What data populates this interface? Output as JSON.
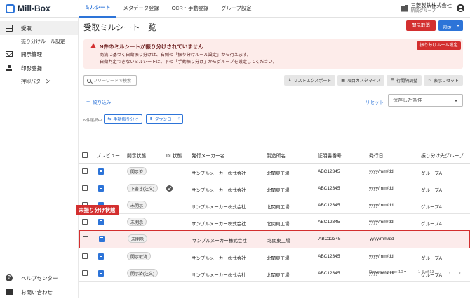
{
  "app": {
    "logo": "Mill-Box"
  },
  "nav": {
    "tabs": [
      "ミルシート",
      "メタデータ登録",
      "OCR・手動登録",
      "グループ設定"
    ],
    "active": 0
  },
  "company": {
    "name": "三菱製鉄株式会社",
    "group": "所属グループ"
  },
  "sidebar": {
    "items": [
      {
        "label": "受取",
        "icon": "inbox-icon",
        "active": true
      },
      {
        "label": "振り分けルール設定",
        "sub": true
      },
      {
        "label": "開示管理",
        "icon": "mail-icon"
      },
      {
        "label": "印影登録",
        "icon": "stamp-icon"
      },
      {
        "label": "押印パターン",
        "sub": true
      }
    ],
    "bottom": [
      {
        "label": "ヘルプセンター",
        "icon": "help-icon"
      },
      {
        "label": "お問い合わせ",
        "icon": "envelope-icon"
      }
    ]
  },
  "page": {
    "title": "受取ミルシート一覧",
    "cancel_disclosure": "開示取消",
    "disclose": "開示"
  },
  "alert": {
    "title": "N件のミルシートが振り分けされていません",
    "line1": "商流に基づく自動振り分けは、右側の「振り分けルール設定」から行えます。",
    "line2": "自動判定できないミルシートは、下の「手動振り分け」からグループを設定してください。",
    "button": "振り分けルール設定"
  },
  "toolbar": {
    "search_placeholder": "フリーワードで検索",
    "buttons": [
      "リストエクスポート",
      "項目カスタマイズ",
      "行間隔調整",
      "表示リセット"
    ]
  },
  "filter": {
    "narrow": "絞り込み",
    "reset": "リセット",
    "saved_conditions": "保存した条件"
  },
  "selection": {
    "count": "N件選択中",
    "manual_assign": "手動振り分け",
    "download": "ダウンロード"
  },
  "table": {
    "headers": [
      "プレビュー",
      "開示状態",
      "DL状態",
      "発行メーカー名",
      "製造所名",
      "証明書番号",
      "発行日",
      "振り分け先グループ"
    ],
    "rows": [
      {
        "status": "開示済",
        "dl": false,
        "maker": "サンプルメーカー株式会社",
        "plant": "北関東工場",
        "cert": "ABC12345",
        "date": "yyyy/mm/dd",
        "group": "グループA"
      },
      {
        "status": "下書き(注文)",
        "dl": true,
        "maker": "サンプルメーカー株式会社",
        "plant": "北関東工場",
        "cert": "ABC12345",
        "date": "yyyy/mm/dd",
        "group": "グループA"
      },
      {
        "status": "未開示",
        "dl": false,
        "maker": "サンプルメーカー株式会社",
        "plant": "北関東工場",
        "cert": "ABC12345",
        "date": "yyyy/mm/dd",
        "group": "グループA"
      },
      {
        "status": "未開示",
        "dl": false,
        "maker": "サンプルメーカー株式会社",
        "plant": "北関東工場",
        "cert": "ABC12345",
        "date": "yyyy/mm/dd",
        "group": "グループA"
      },
      {
        "status": "未開示",
        "dl": false,
        "maker": "サンプルメーカー株式会社",
        "plant": "北関東工場",
        "cert": "ABC12345",
        "date": "yyyy/mm/dd",
        "group": "",
        "highlight": true
      },
      {
        "status": "開示取消",
        "dl": false,
        "maker": "サンプルメーカー株式会社",
        "plant": "北関東工場",
        "cert": "ABC12345",
        "date": "yyyy/mm/dd",
        "group": "グループA"
      },
      {
        "status": "開示済(注文)",
        "dl": false,
        "maker": "サンプルメーカー株式会社",
        "plant": "北関東工場",
        "cert": "ABC12345",
        "date": "yyyy/mm/dd",
        "group": "グループA"
      }
    ],
    "unassigned_tag": "未振り分け状態"
  },
  "pagination": {
    "rows_label": "Rows per page:",
    "rows_value": "10",
    "range": "1-5 of 13"
  },
  "colors": {
    "accent": "#2d74d8",
    "danger": "#d32f2f",
    "alert_bg": "#fdecea"
  }
}
